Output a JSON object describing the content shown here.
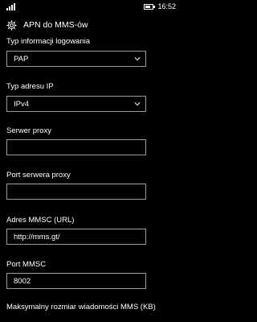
{
  "status": {
    "time": "16:52"
  },
  "header": {
    "title": "APN do MMS-ów",
    "icon": "gear-icon"
  },
  "fields": {
    "login_type": {
      "label": "Typ informacji logowania",
      "value": "PAP"
    },
    "ip_type": {
      "label": "Typ adresu IP",
      "value": "IPv4"
    },
    "proxy_server": {
      "label": "Serwer proxy",
      "value": ""
    },
    "proxy_port": {
      "label": "Port serwera proxy",
      "value": ""
    },
    "mmsc_url": {
      "label": "Adres MMSC (URL)",
      "value": "http://mms.gt/"
    },
    "mmsc_port": {
      "label": "Port MMSC",
      "value": "8002"
    },
    "max_size": {
      "label": "Maksymalny rozmiar wiadomości MMS (KB)"
    }
  }
}
